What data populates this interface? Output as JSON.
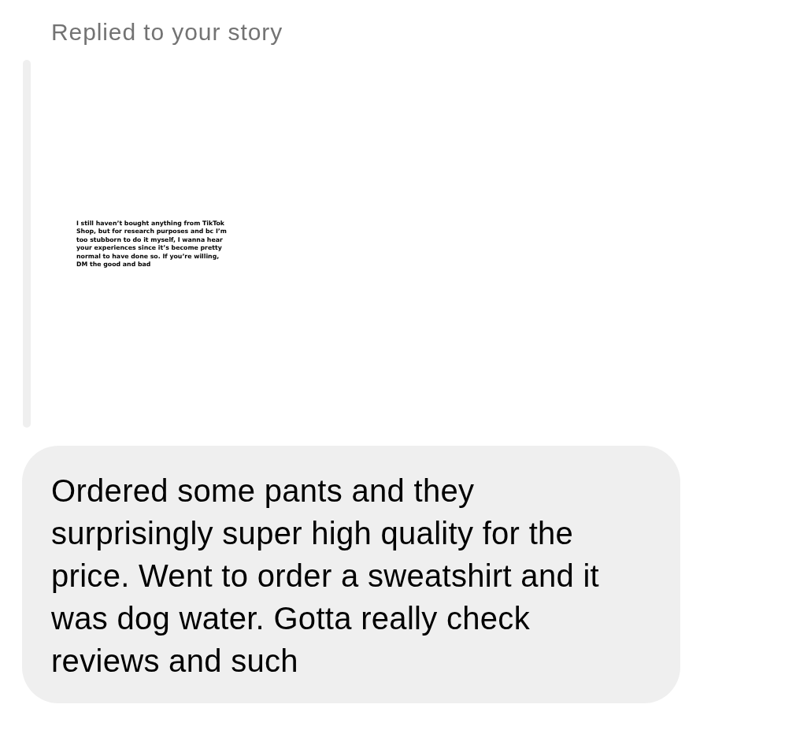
{
  "header": {
    "text": "Replied to your story"
  },
  "story": {
    "text": "I still haven’t bought anything from TikTok Shop, but for research purposes and bc I’m too stubborn to do it myself, I wanna hear your experiences since it’s become pretty normal to have done so. If you’re willing, DM the good and bad"
  },
  "message": {
    "text": "Ordered some pants and they surprisingly super high quality for the price. Went to order a sweatshirt and it was dog water. Gotta really check reviews and such"
  }
}
